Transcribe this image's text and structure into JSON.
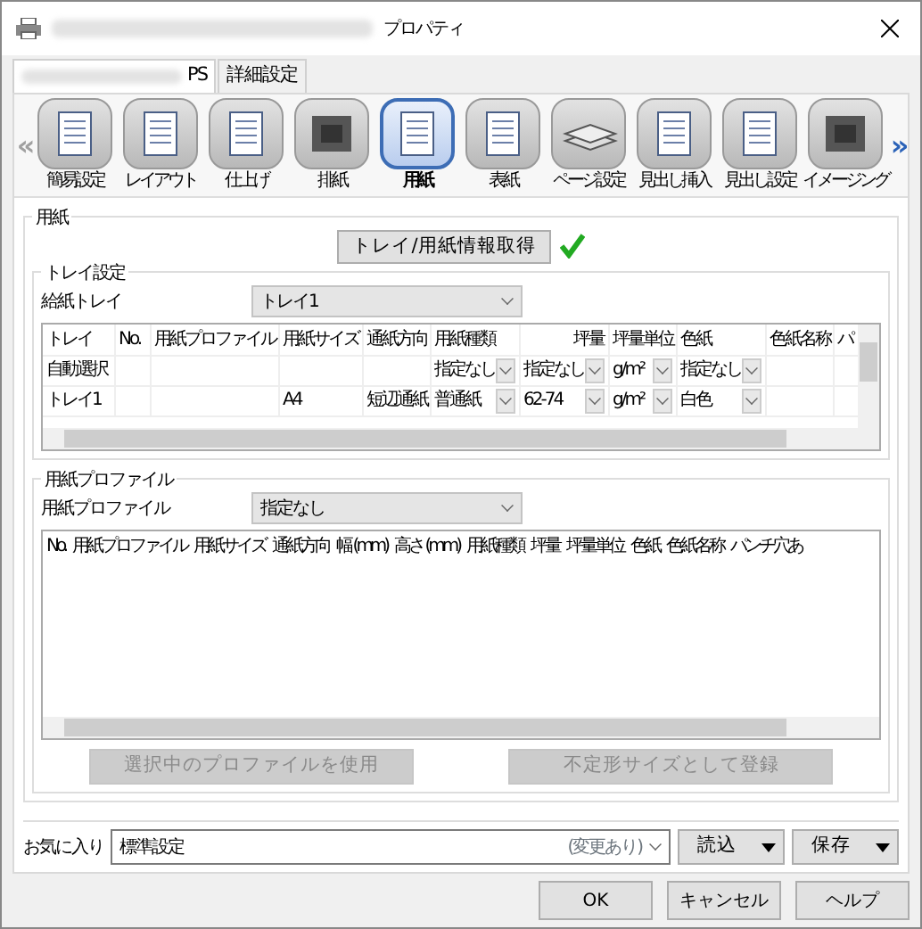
{
  "window": {
    "title": "プロパティ"
  },
  "tabs": [
    {
      "label": "PS",
      "selected": true
    },
    {
      "label": "詳細設定",
      "selected": false
    }
  ],
  "toolbar": {
    "items": [
      {
        "label": "簡易設定",
        "selected": false,
        "kind": "doc"
      },
      {
        "label": "レイアウト",
        "selected": false,
        "kind": "doc"
      },
      {
        "label": "仕上げ",
        "selected": false,
        "kind": "doc"
      },
      {
        "label": "排紙",
        "selected": false,
        "kind": "box"
      },
      {
        "label": "用紙",
        "selected": true,
        "kind": "doc"
      },
      {
        "label": "表紙",
        "selected": false,
        "kind": "doc"
      },
      {
        "label": "ページ設定",
        "selected": false,
        "kind": "stack"
      },
      {
        "label": "見出し挿入",
        "selected": false,
        "kind": "doc"
      },
      {
        "label": "見出し設定",
        "selected": false,
        "kind": "doc"
      },
      {
        "label": "イメージング",
        "selected": false,
        "kind": "box"
      }
    ],
    "prev_label": "«",
    "next_label": "»",
    "prev_enabled": false,
    "next_enabled": true
  },
  "paper_group": {
    "title": "用紙",
    "fetch_button": "トレイ/用紙情報取得",
    "fetch_ok": true
  },
  "tray_group": {
    "title": "トレイ設定",
    "tray_label": "給紙トレイ",
    "tray_value": "トレイ1",
    "table": {
      "columns": [
        "トレイ",
        "No.",
        "用紙プロファイル",
        "用紙サイズ",
        "通紙方向",
        "用紙種類",
        "坪量",
        "坪量単位",
        "色紙",
        "色紙名称",
        "パ"
      ],
      "rows": [
        [
          {
            "kind": "text",
            "text": "自動選択"
          },
          null,
          null,
          null,
          null,
          {
            "kind": "combo",
            "text": "指定なし"
          },
          {
            "kind": "combo",
            "text": "指定なし"
          },
          {
            "kind": "combo",
            "text": "g/m²"
          },
          {
            "kind": "combo",
            "text": "指定なし"
          },
          null,
          null
        ],
        [
          {
            "kind": "text",
            "text": "トレイ1"
          },
          null,
          null,
          {
            "kind": "text",
            "text": "A4"
          },
          {
            "kind": "text",
            "text": "短辺通紙"
          },
          {
            "kind": "combo",
            "text": "普通紙"
          },
          {
            "kind": "combo",
            "text": "62-74"
          },
          {
            "kind": "combo",
            "text": "g/m²"
          },
          {
            "kind": "combo",
            "text": "白色"
          },
          null,
          null
        ]
      ]
    }
  },
  "profile_group": {
    "title": "用紙プロファイル",
    "profile_label": "用紙プロファイル",
    "profile_value": "指定なし",
    "table": {
      "columns": [
        "No.",
        "用紙プロファイル",
        "用紙サイズ",
        "通紙方向",
        "幅 (mm)",
        "高さ (mm)",
        "用紙種類",
        "坪量",
        "坪量単位",
        "色紙",
        "色紙名称",
        "パンチ穴あ"
      ]
    },
    "buttons": [
      {
        "label": "選択中のプロファイルを使用",
        "disabled": true
      },
      {
        "label": "不定形サイズとして登録",
        "disabled": true
      }
    ]
  },
  "favorites": {
    "label": "お気に入り",
    "value": "標準設定",
    "status": "(変更あり)",
    "load_button": "読込",
    "save_button": "保存"
  },
  "buttons": [
    "OK",
    "キャンセル",
    "ヘルプ"
  ]
}
